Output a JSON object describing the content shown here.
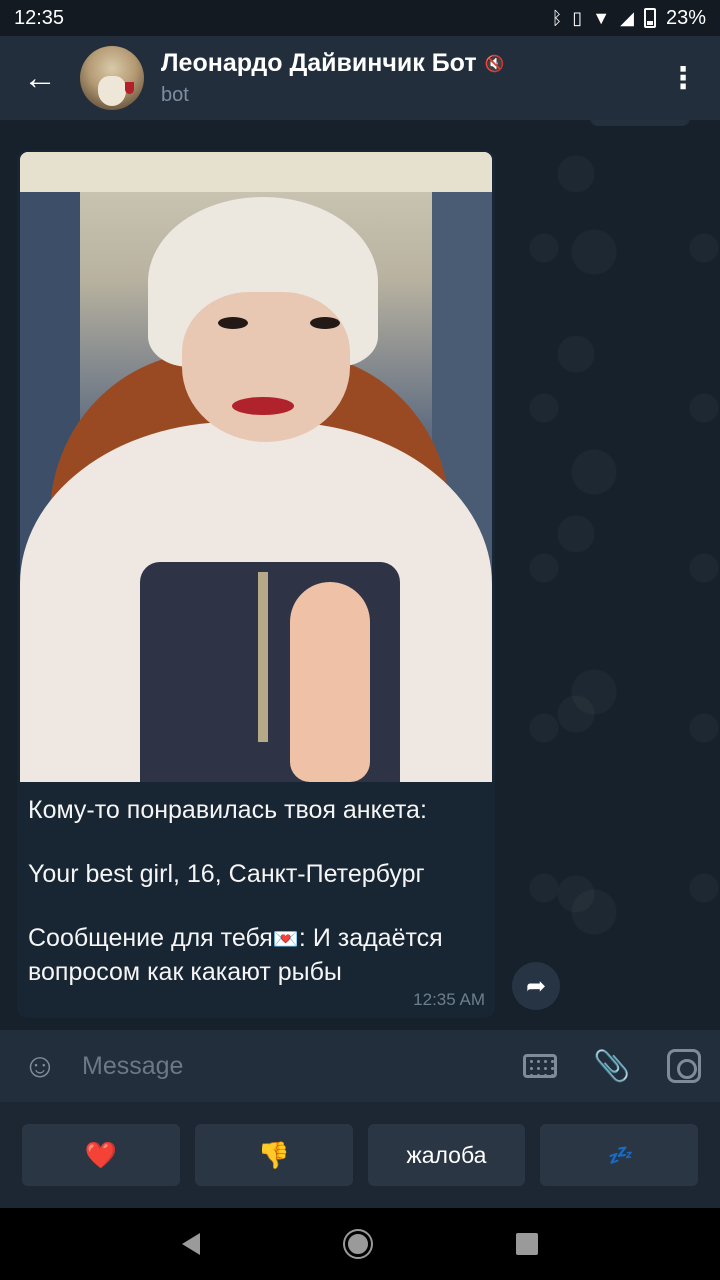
{
  "status_bar": {
    "time": "12:35",
    "battery": "23%",
    "icons": [
      "bluetooth-icon",
      "vibrate-icon",
      "wifi-icon",
      "signal-icon",
      "battery-icon"
    ]
  },
  "header": {
    "title": "Леонардо Дайвинчик Бот",
    "subtitle": "bot",
    "icons": [
      "back-arrow-icon",
      "mute-icon",
      "more-vert-icon"
    ]
  },
  "message": {
    "line1": "Кому-то понравилась твоя анкета:",
    "line2": "Your best girl, 16, Санкт-Петербург",
    "line3_prefix": "Сообщение для тебя",
    "line3_emoji": "💌",
    "line3_suffix": ": И задаётся вопросом как какают рыбы",
    "time": "12:35 AM"
  },
  "input": {
    "placeholder": "Message"
  },
  "bot_keyboard": {
    "buttons": [
      "❤️",
      "👎",
      "жалоба",
      "💤"
    ]
  },
  "colors": {
    "header_bg": "#232e3c",
    "chat_bg": "#17212b",
    "bubble_bg": "#182533",
    "kb_button_bg": "#2b3644"
  }
}
